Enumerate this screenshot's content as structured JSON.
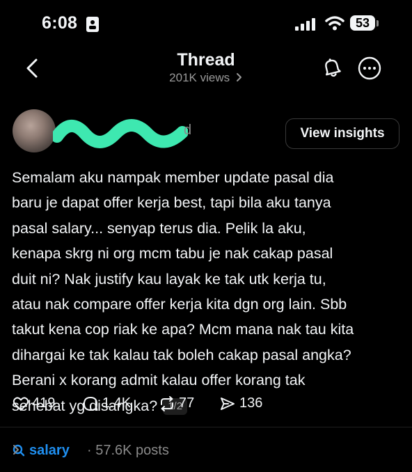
{
  "status_bar": {
    "time": "6:08",
    "battery": "53"
  },
  "header": {
    "title": "Thread",
    "views": "201K views"
  },
  "post": {
    "username_tail": "d",
    "view_insights_label": "View insights",
    "lines": [
      "Semalam aku nampak member update pasal dia",
      "baru je dapat offer kerja best, tapi bila aku tanya",
      "pasal salary... senyap terus dia. Pelik la aku,",
      "kenapa skrg ni org mcm tabu je nak cakap pasal",
      "duit ni? Nak justify kau layak ke tak utk kerja tu,",
      "atau nak compare offer kerja kita dgn org lain. Sbb",
      "takut kena cop riak ke apa? Mcm mana nak tau kita",
      "dihargai ke tak kalau tak boleh cakap pasal angka?",
      "Berani x korang admit kalau offer korang tak",
      "sehebat yg disangka?"
    ],
    "page_indicator": "1/2"
  },
  "actions": {
    "likes": "419",
    "replies": "1.4K",
    "reposts": "77",
    "shares": "136"
  },
  "topic": {
    "name": "salary",
    "meta": "· 57.6K posts"
  },
  "colors": {
    "background": "#000000",
    "text": "#f3f5f7",
    "muted": "#8a8a8a",
    "link": "#1f8ff0",
    "redaction": "#3ee8b0"
  }
}
